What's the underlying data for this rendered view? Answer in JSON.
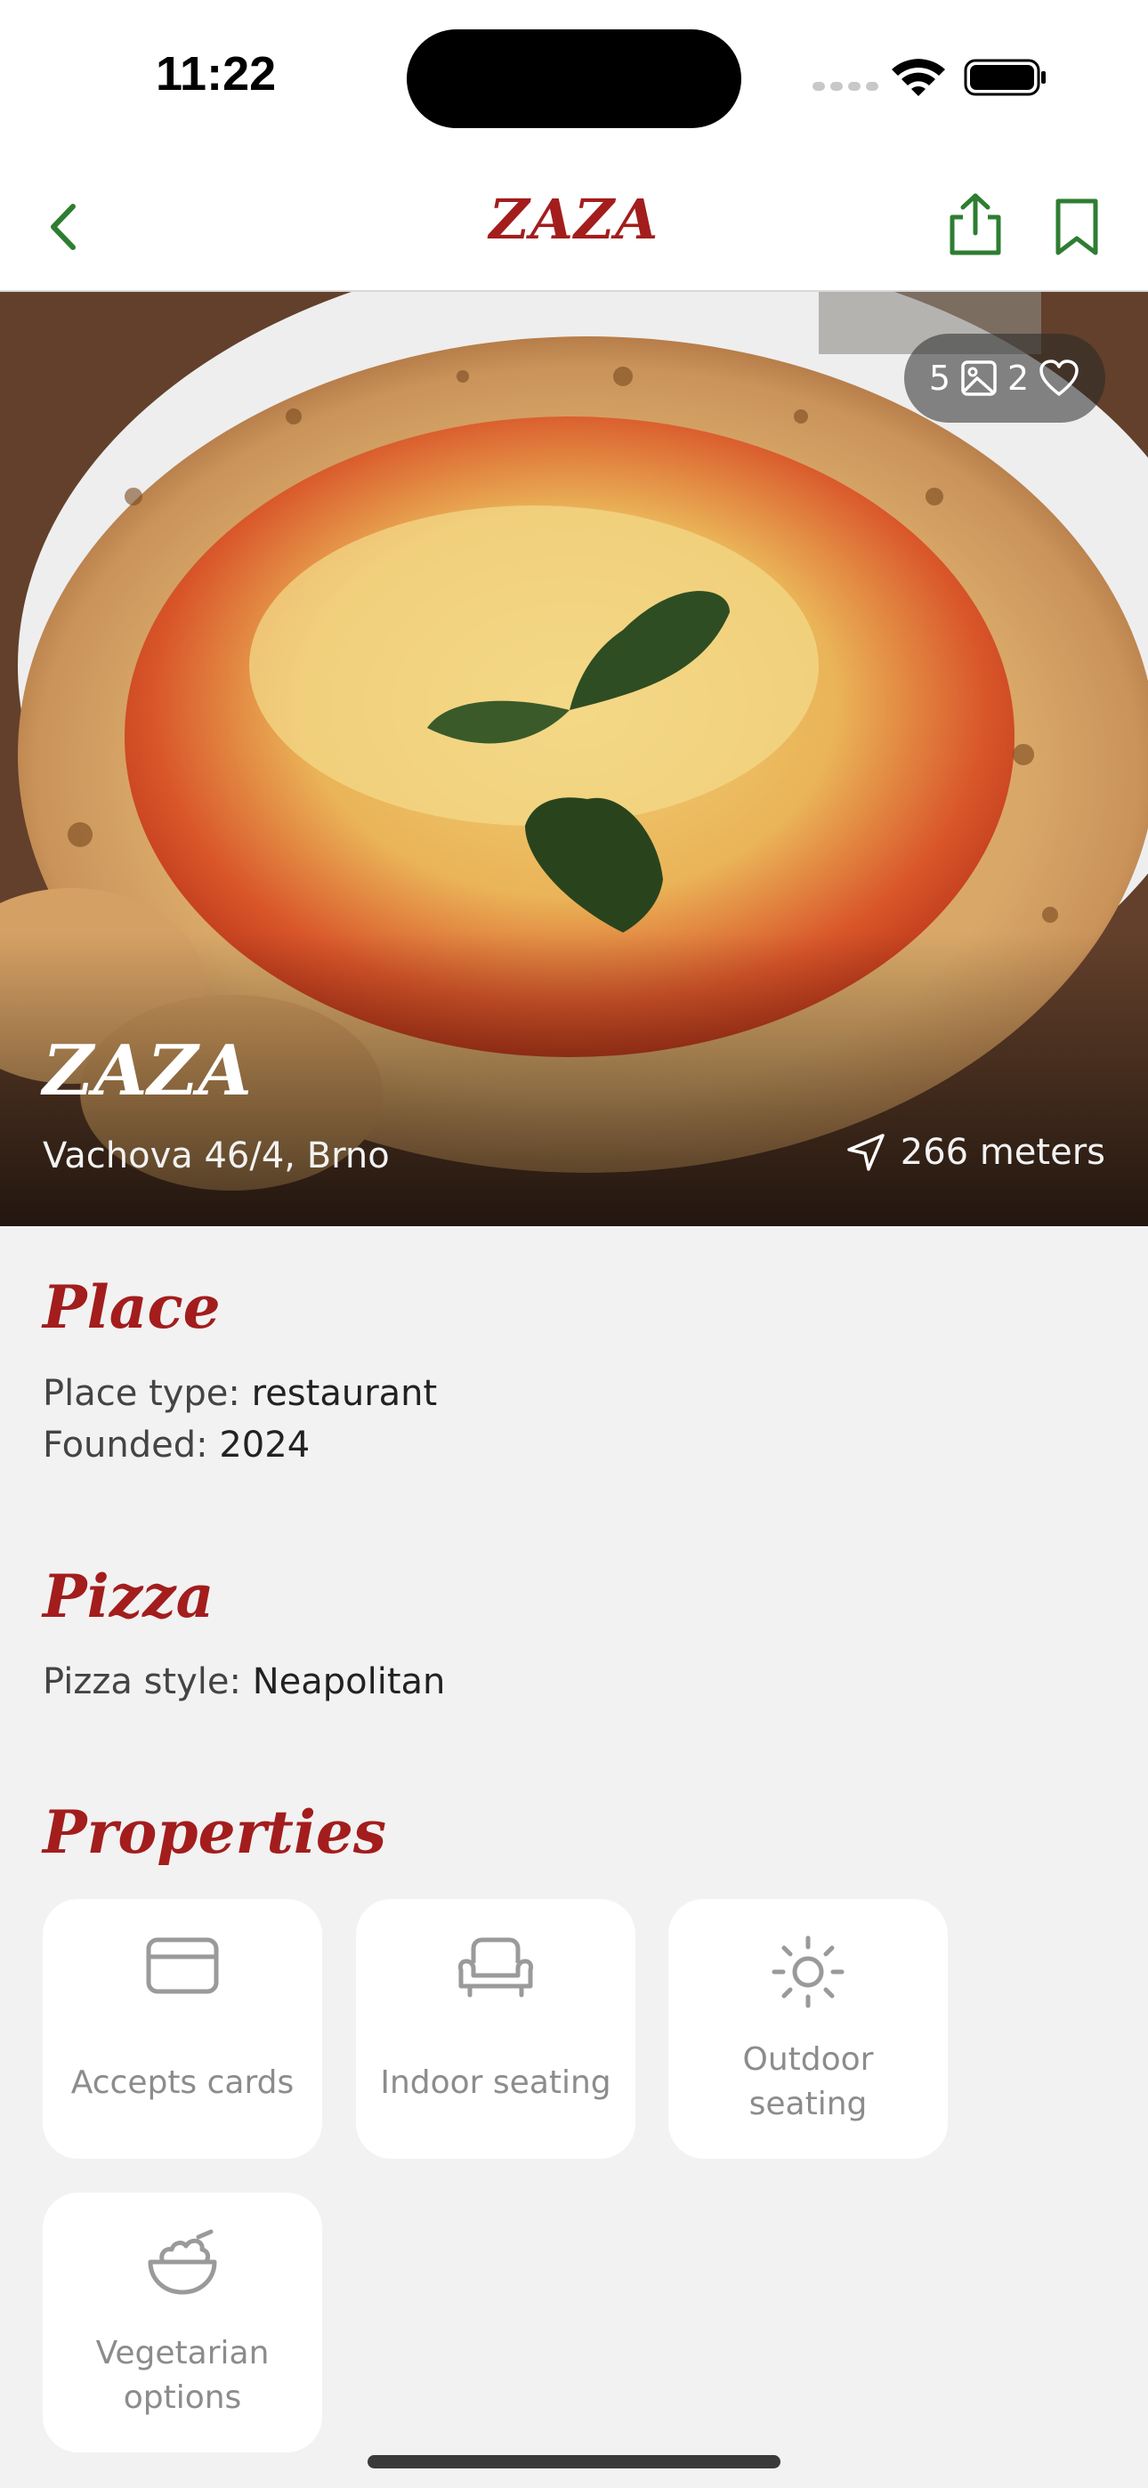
{
  "status": {
    "time": "11:22"
  },
  "nav": {
    "title": "ZAZA"
  },
  "hero": {
    "photo_count": "5",
    "like_count": "2",
    "title": "ZAZA",
    "address": "Vachova 46/4, Brno",
    "distance": "266 meters"
  },
  "place": {
    "heading": "Place",
    "type_label": "Place type:",
    "type_value": "restaurant",
    "founded_label": "Founded:",
    "founded_value": "2024"
  },
  "pizza": {
    "heading": "Pizza",
    "style_label": "Pizza style:",
    "style_value": "Neapolitan"
  },
  "properties": {
    "heading": "Properties",
    "items": [
      {
        "label": "Accepts cards",
        "icon": "credit-card-icon"
      },
      {
        "label": "Indoor seating",
        "icon": "sofa-icon"
      },
      {
        "label": "Outdoor seating",
        "icon": "sun-icon"
      },
      {
        "label": "Vegetarian options",
        "icon": "salad-bowl-icon"
      }
    ]
  },
  "colors": {
    "accent": "#a31d1d",
    "nav_icon": "#2e7d32",
    "background": "#f2f2f2"
  }
}
